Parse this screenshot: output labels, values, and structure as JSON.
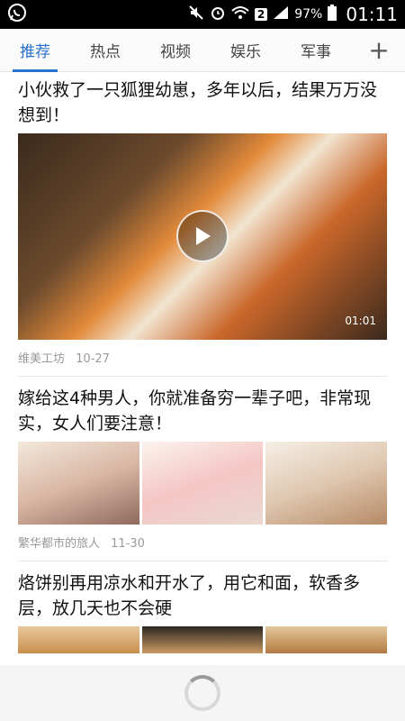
{
  "status_bar": {
    "battery": "97%",
    "time": "01:11",
    "sim": "2"
  },
  "tabs": [
    {
      "label": "推荐",
      "active": true
    },
    {
      "label": "热点",
      "active": false
    },
    {
      "label": "视频",
      "active": false
    },
    {
      "label": "娱乐",
      "active": false
    },
    {
      "label": "军事",
      "active": false
    }
  ],
  "add_tab_symbol": "+",
  "articles": [
    {
      "title": "小伙救了一只狐狸幼崽，多年以后，结果万万没想到！",
      "type": "video",
      "duration": "01:01",
      "source": "维美工坊",
      "date": "10-27"
    },
    {
      "title": "嫁给这4种男人，你就准备穷一辈子吧，非常现实，女人们要注意！",
      "type": "images",
      "source": "繁华都市的旅人",
      "date": "11-30"
    },
    {
      "title": "烙饼别再用凉水和开水了，用它和面，软香多层，放几天也不会硬",
      "type": "images"
    }
  ],
  "colors": {
    "accent": "#2a71d0",
    "meta_text": "#999999",
    "status_bar_bg": "#000000"
  }
}
